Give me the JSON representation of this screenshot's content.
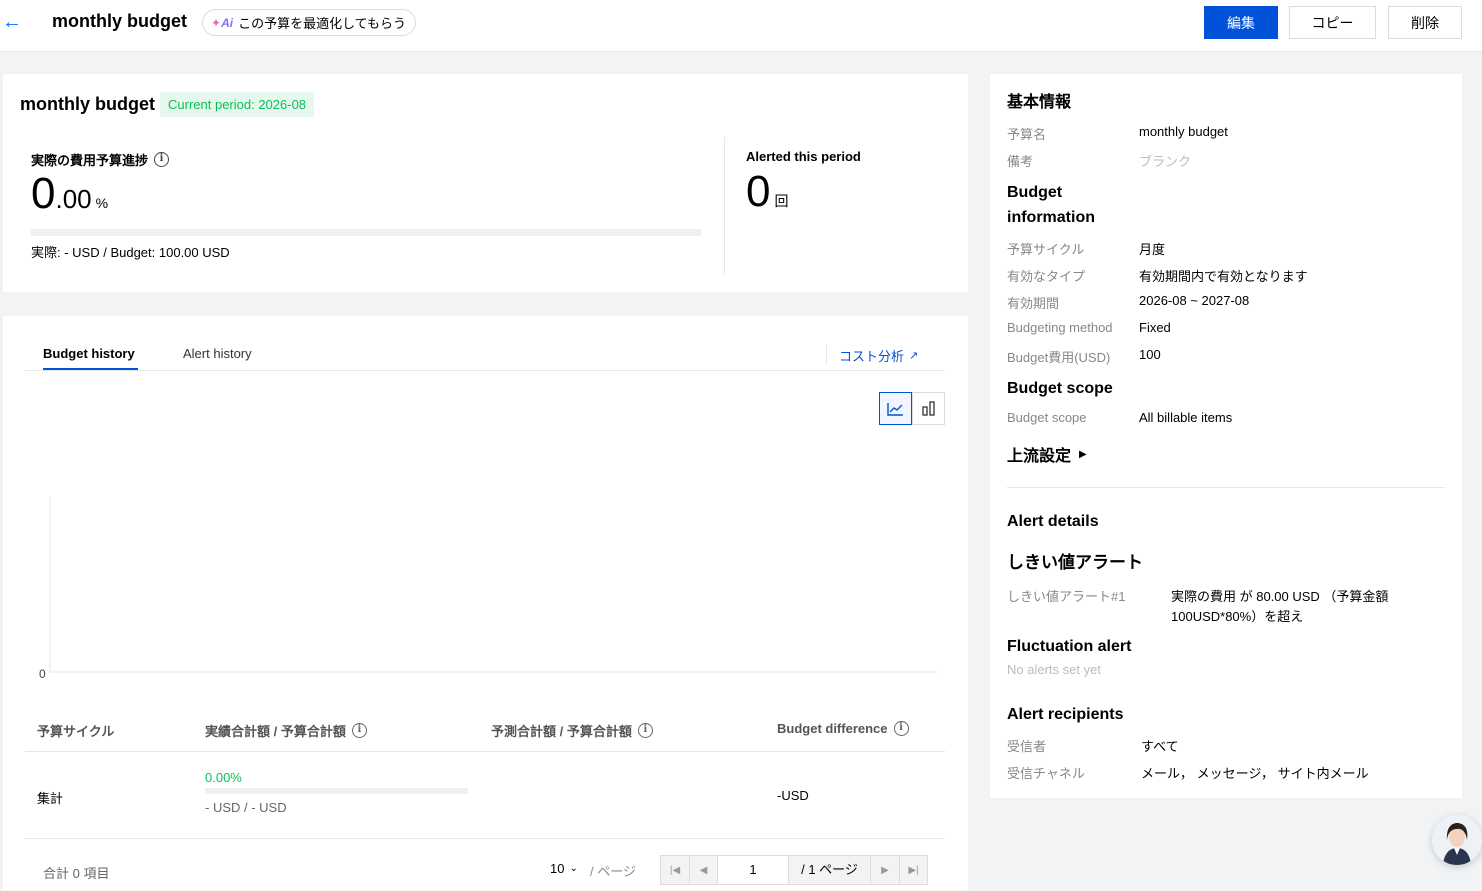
{
  "header": {
    "title": "monthly budget",
    "ai_chip_icon": "Ai",
    "ai_chip_label": "この予算を最適化してもらう",
    "edit_label": "編集",
    "copy_label": "コピー",
    "delete_label": "削除"
  },
  "summary": {
    "name": "monthly budget",
    "period_badge": "Current period: 2026-08",
    "progress_title": "実際の費用予算進捗",
    "progress_int": "0",
    "progress_dec": ".00",
    "progress_unit": "%",
    "progress_fraction": 0,
    "progress_sub": "実際: - USD / Budget: 100.00 USD",
    "alerted_title": "Alerted this period",
    "alerted_count": "0",
    "alerted_unit": "回"
  },
  "history": {
    "tabs": [
      "Budget history",
      "Alert history"
    ],
    "cost_link": "コスト分析",
    "chart_zero": "0",
    "table": {
      "headers": [
        "予算サイクル",
        "実績合計額 / 予算合計額",
        "予測合計額 / 予算合計額",
        "Budget difference"
      ],
      "row": {
        "cycle": "集計",
        "actual_pct": "0.00%",
        "actual_sub": "- USD / - USD",
        "difference": "-USD"
      }
    },
    "pagination": {
      "total": "合計 0 項目",
      "page_size": "10",
      "page_size_unit": "/ ページ",
      "current_page": "1",
      "total_pages": "/ 1 ページ"
    }
  },
  "info": {
    "basic_title": "基本情報",
    "basic": [
      {
        "key": "予算名",
        "value": "monthly budget"
      },
      {
        "key": "備考",
        "value": "ブランク"
      }
    ],
    "budget_info_title_1": "Budget",
    "budget_info_title_2": "information",
    "budget_info": [
      {
        "key": "予算サイクル",
        "value": "月度"
      },
      {
        "key": "有効なタイプ",
        "value": "有効期間内で有効となります"
      },
      {
        "key": "有効期間",
        "value": "2026-08 ~ 2027-08"
      },
      {
        "key": "Budgeting method",
        "value": "Fixed"
      },
      {
        "key": "Budget費用(USD)",
        "value": "100"
      }
    ],
    "scope_title": "Budget scope",
    "scope": [
      {
        "key": "Budget scope",
        "value": "All billable items"
      }
    ],
    "upstream_label": "上流設定",
    "alert_details_title": "Alert details",
    "threshold_title": "しきい値アラート",
    "threshold_key": "しきい値アラート#1",
    "threshold_value_1": "実際の費用 が 80.00 USD （予算金額",
    "threshold_value_2": "100USD*80%）を超え",
    "fluctuation_title": "Fluctuation alert",
    "fluctuation_empty": "No alerts set yet",
    "recipients_title": "Alert recipients",
    "recipients": [
      {
        "key": "受信者",
        "value": "すべて"
      },
      {
        "key": "受信チャネル",
        "value": "メール， メッセージ， サイト内メール"
      }
    ]
  },
  "colors": {
    "primary": "#0052d9",
    "success": "#0abf5b",
    "link": "#006eff"
  }
}
